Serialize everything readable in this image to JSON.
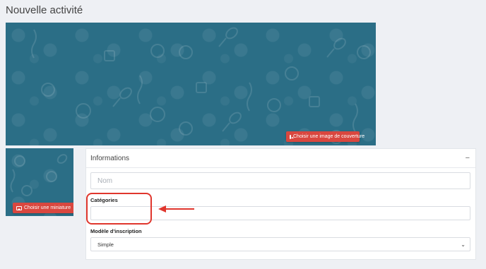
{
  "page": {
    "title": "Nouvelle activité"
  },
  "cover": {
    "button_label": "Choisir une image de couverture",
    "button_icon": "image-icon",
    "background_color": "#2b6e86"
  },
  "thumbnail": {
    "button_label": "Choisir une miniature",
    "button_icon": "image-icon"
  },
  "informations": {
    "title": "Informations",
    "collapse_icon": "minus-icon",
    "name_placeholder": "Nom",
    "name_value": "",
    "categories_label": "Catégories",
    "categories_value": "",
    "model_label": "Modèle d'inscription",
    "model_value": "Simple"
  },
  "annotation": {
    "color": "#e0362d"
  },
  "colors": {
    "accent_button": "#d9473f",
    "background": "#eef0f4"
  }
}
